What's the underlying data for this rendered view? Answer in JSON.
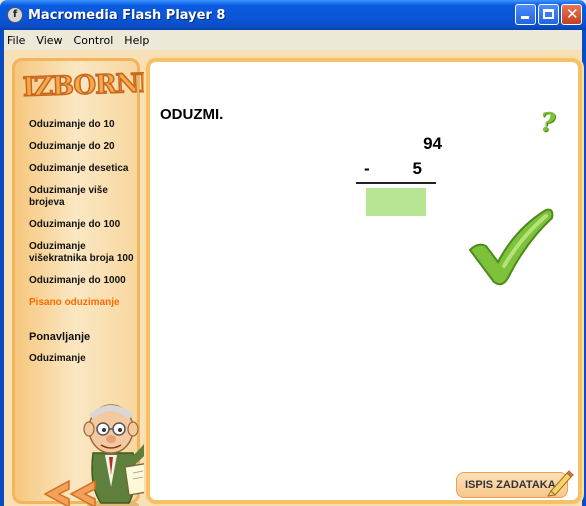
{
  "window": {
    "title": "Macromedia Flash Player 8",
    "menu": [
      "File",
      "View",
      "Control",
      "Help"
    ]
  },
  "sidebar": {
    "logo": "IZBORNIK",
    "items": [
      {
        "label": "Oduzimanje do 10"
      },
      {
        "label": "Oduzimanje do 20"
      },
      {
        "label": "Oduzimanje desetica"
      },
      {
        "label": "Oduzimanje više brojeva"
      },
      {
        "label": "Oduzimanje do 100"
      },
      {
        "label": "Oduzimanje višekratnika broja 100"
      },
      {
        "label": "Oduzimanje do 1000"
      },
      {
        "label": "Pisano oduzimanje",
        "active": true
      }
    ],
    "section_title": "Ponavljanje",
    "section_item": "Oduzimanje"
  },
  "task": {
    "title": "ODUZMI.",
    "minuend": "94",
    "operator": "-",
    "subtrahend": "5",
    "answer": ""
  },
  "buttons": {
    "print_label": "ISPIS ZADATAKA",
    "help_glyph": "?"
  },
  "colors": {
    "accent": "#ff6a00",
    "check": "#7dc23a",
    "answer_box": "#b6e694"
  }
}
